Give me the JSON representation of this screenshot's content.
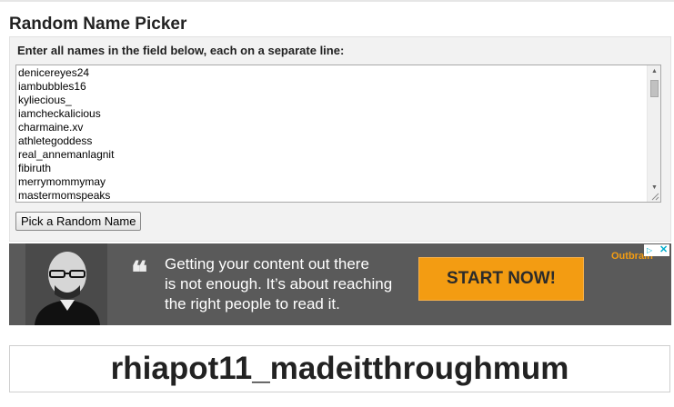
{
  "page": {
    "title": "Random Name Picker"
  },
  "form": {
    "instructions": "Enter all names in the field below, each on a separate line:",
    "names": [
      "denicereyes24",
      "iambubbles16",
      "kyliecious_",
      "iamcheckalicious",
      "charmaine.xv",
      "athletegoddess",
      "real_annemanlagnit",
      "fibiruth",
      "merrymommymay",
      "mastermomspeaks"
    ],
    "pick_button_label": "Pick a Random Name"
  },
  "ad": {
    "quote_mark": "❝",
    "headline_lines": [
      "Getting your content out there",
      "is not enough. It’s about reaching",
      "the right people to read it."
    ],
    "cta_label": "START NOW!",
    "brand": "Outbrain",
    "choices_icon": "ad-choices-icon",
    "close_icon": "close-icon",
    "colors": {
      "background": "#5a5a5a",
      "cta": "#f39c12"
    }
  },
  "result": {
    "picked_name": "rhiapot11_madeitthroughmum"
  }
}
